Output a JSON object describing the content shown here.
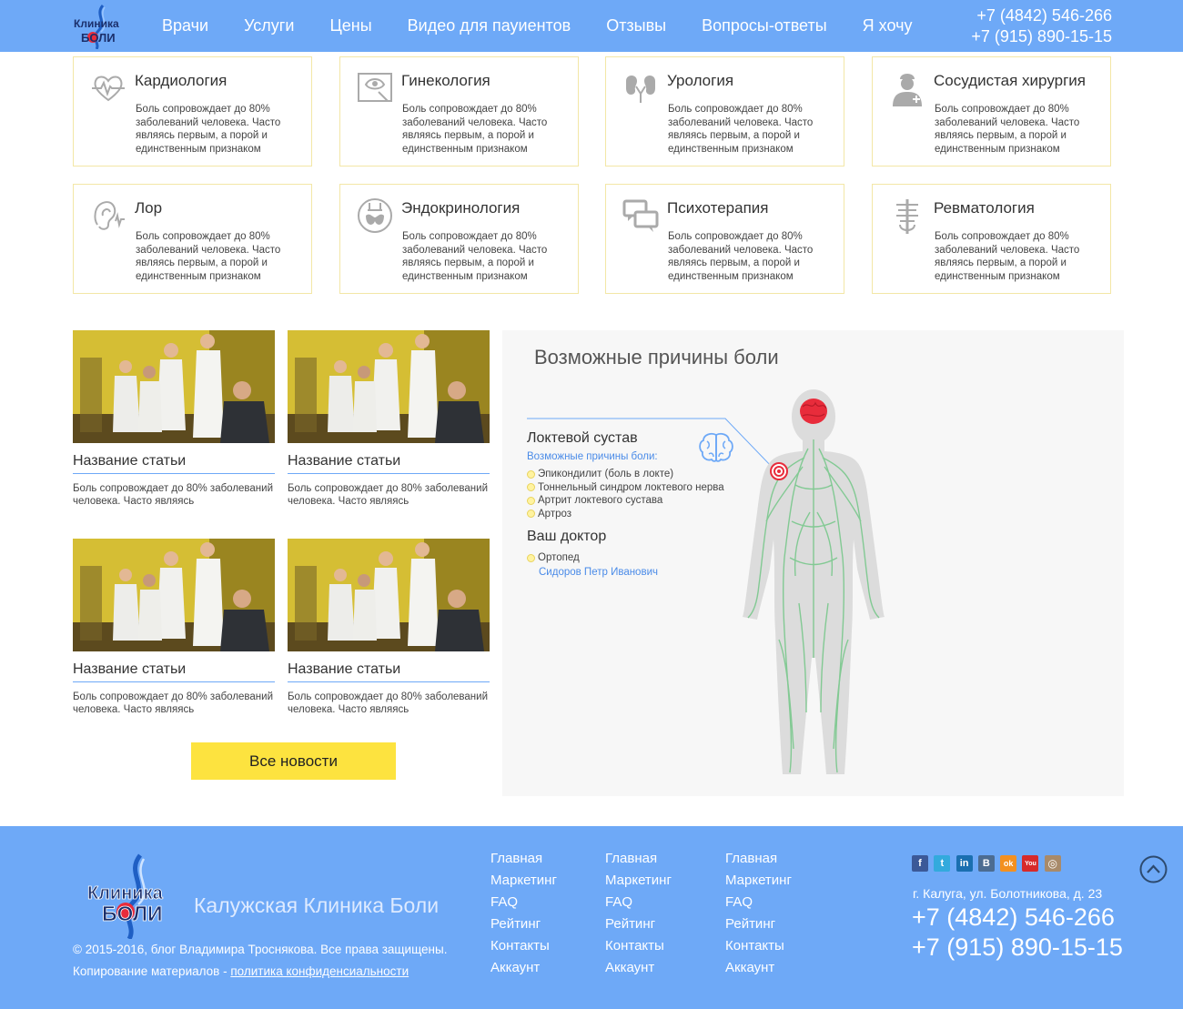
{
  "header": {
    "logo_icon": "clinic-logo",
    "nav": [
      "Врачи",
      "Услуги",
      "Цены",
      "Видео для пауиентов",
      "Отзывы",
      "Вопросы-ответы",
      "Я хочу"
    ],
    "phone1": "+7 (4842) 546-266",
    "phone2": "+7 (915) 890-15-15",
    "bg_color": "#6ea9f7"
  },
  "services": [
    {
      "title": "Кардиология",
      "icon": "heart-pulse-icon",
      "desc": "Боль сопровождает до 80% заболеваний человека. Часто являясь первым, а порой и единственным признаком"
    },
    {
      "title": "Гинекология",
      "icon": "gynecology-icon",
      "desc": "Боль сопровождает до 80% заболеваний человека. Часто являясь первым, а порой и единственным признаком"
    },
    {
      "title": "Урология",
      "icon": "kidneys-icon",
      "desc": "Боль сопровождает до 80% заболеваний человека. Часто являясь первым, а порой и единственным признаком"
    },
    {
      "title": "Сосудистая хирургия",
      "icon": "surgeon-icon",
      "desc": "Боль сопровождает до 80% заболеваний человека. Часто являясь первым, а порой и единственным признаком"
    },
    {
      "title": "Лор",
      "icon": "ear-icon",
      "desc": "Боль сопровождает до 80% заболеваний человека. Часто являясь первым, а порой и единственным признаком"
    },
    {
      "title": "Эндокринология",
      "icon": "thyroid-icon",
      "desc": "Боль сопровождает до 80% заболеваний человека. Часто являясь первым, а порой и единственным признаком"
    },
    {
      "title": "Психотерапия",
      "icon": "chat-bubbles-icon",
      "desc": "Боль сопровождает до 80% заболеваний человека. Часто являясь первым, а порой и единственным признаком"
    },
    {
      "title": "Ревматология",
      "icon": "spine-icon",
      "desc": "Боль сопровождает до 80% заболеваний человека. Часто являясь первым, а порой и единственным признаком"
    }
  ],
  "articles": [
    {
      "title": "Название статьи",
      "desc": "Боль сопровождает до 80% заболеваний человека. Часто являясь"
    },
    {
      "title": "Название статьи",
      "desc": "Боль сопровождает до 80% заболеваний человека. Часто являясь"
    },
    {
      "title": "Название статьи",
      "desc": "Боль сопровождает до 80% заболеваний человека. Часто являясь"
    },
    {
      "title": "Название статьи",
      "desc": "Боль сопровождает до 80% заболеваний человека. Часто являясь"
    }
  ],
  "all_news_label": "Все новости",
  "pain_panel": {
    "title": "Возможные причины боли",
    "joint": "Локтевой сустав",
    "causes_label": "Возможные причины боли:",
    "causes": [
      "Эпикондилит (боль в локте)",
      "Тоннельный синдром локтевого нерва",
      "Артрит локтевого сустава",
      "Артроз"
    ],
    "doctor_title": "Ваш доктор",
    "doctor_role": "Ортопед",
    "doctor_name": "Сидоров Петр Иванович",
    "link_color": "#4a8be8",
    "nerve_color": "#7ec990",
    "highlight_color": "#e82c3b"
  },
  "footer": {
    "brand": "Калужская Клиника Боли",
    "copyright": "© 2015-2016, блог Владимира Троснякова. Все права защищены.",
    "copy_prefix": "Копирование материалов - ",
    "privacy_link": "политика конфиденсиальности",
    "columns": [
      [
        "Главная",
        "Маркетинг",
        "FAQ",
        "Рейтинг",
        "Контакты",
        "Аккаунт"
      ],
      [
        "Главная",
        "Маркетинг",
        "FAQ",
        "Рейтинг",
        "Контакты",
        "Аккаунт"
      ],
      [
        "Главная",
        "Маркетинг",
        "FAQ",
        "Рейтинг",
        "Контакты",
        "Аккаунт"
      ]
    ],
    "socials": [
      {
        "icon": "facebook-icon",
        "glyph": "f",
        "color": "#3b5998"
      },
      {
        "icon": "twitter-icon",
        "glyph": "t",
        "color": "#33aadd"
      },
      {
        "icon": "linkedin-icon",
        "glyph": "in",
        "color": "#1a6fb0"
      },
      {
        "icon": "vk-icon",
        "glyph": "B",
        "color": "#4c6c91"
      },
      {
        "icon": "odnoklassniki-icon",
        "glyph": "ok",
        "color": "#f39020"
      },
      {
        "icon": "youtube-icon",
        "glyph": "You",
        "color": "#d72a2a"
      },
      {
        "icon": "instagram-icon",
        "glyph": "◎",
        "color": "#a88a6a"
      }
    ],
    "address": "г. Калуга, ул. Болотникова, д. 23",
    "phone1": "+7 (4842) 546-266",
    "phone2": "+7 (915) 890-15-15"
  }
}
